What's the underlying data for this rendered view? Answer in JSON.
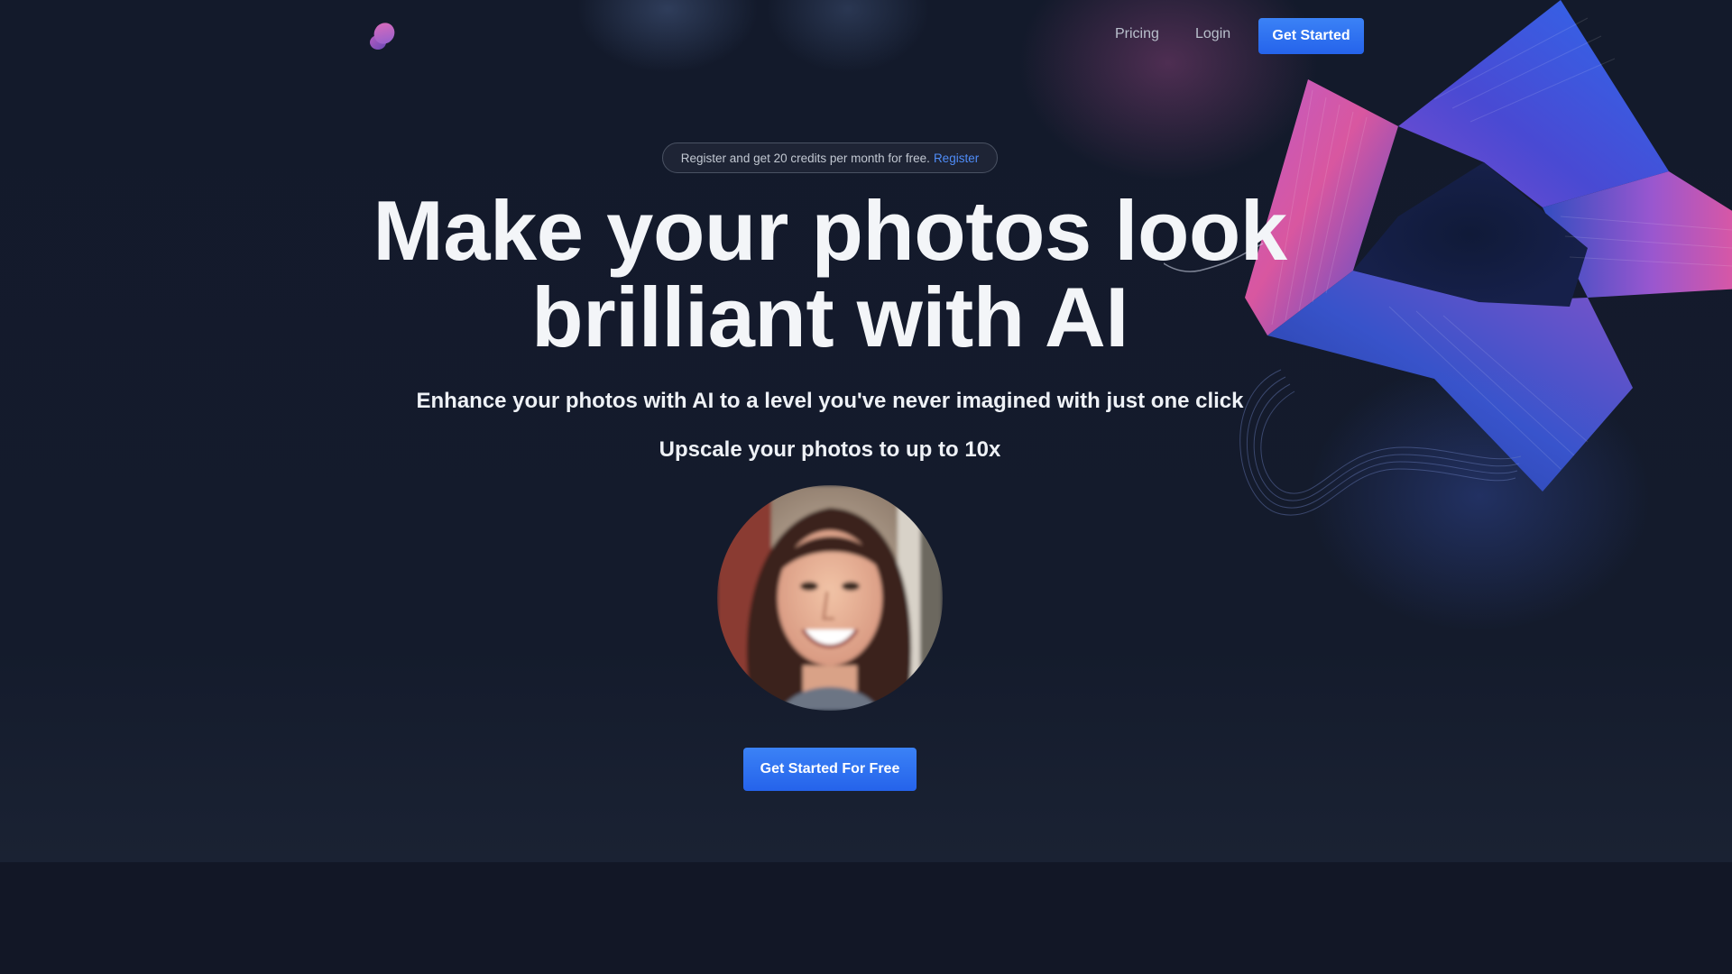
{
  "nav": {
    "logo_icon": "orb-logo-icon",
    "links": [
      "Pricing",
      "Login"
    ],
    "cta_label": "Get Started"
  },
  "promo": {
    "text": "Register and get 20 credits per month for free.",
    "link_label": "Register"
  },
  "hero": {
    "headline_line1": "Make your photos look",
    "headline_line2": "brilliant with AI",
    "subhead": "Enhance your photos with AI to a level you've never imagined with just one click",
    "subhead2": "Upscale your photos to up to 10x",
    "cta_label": "Get Started For Free"
  },
  "colors": {
    "background": "#121726",
    "accent": "#2563eb",
    "link": "#4f8cf7",
    "decor_pink": "#e25aa5",
    "decor_blue": "#2f5cf0"
  }
}
